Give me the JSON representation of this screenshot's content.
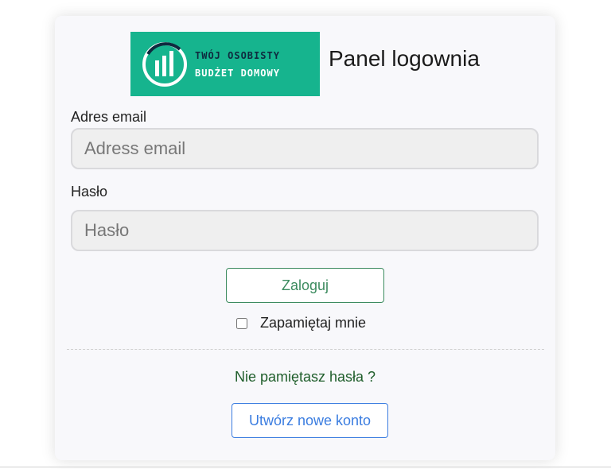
{
  "logo": {
    "line1": "TWÓJ OSOBISTY",
    "line2": "BUDŻET DOMOWY",
    "color": "#16b48e"
  },
  "header": {
    "title": "Panel logownia"
  },
  "form": {
    "email_label": "Adres email",
    "email_placeholder": "Adress email",
    "password_label": "Hasło",
    "password_placeholder": "Hasło",
    "login_button": "Zaloguj",
    "remember_label": "Zapamiętaj mnie",
    "remember_checked": false
  },
  "footer": {
    "forgot_link": "Nie pamiętasz hasła ?",
    "create_account_button": "Utwórz nowe konto"
  }
}
